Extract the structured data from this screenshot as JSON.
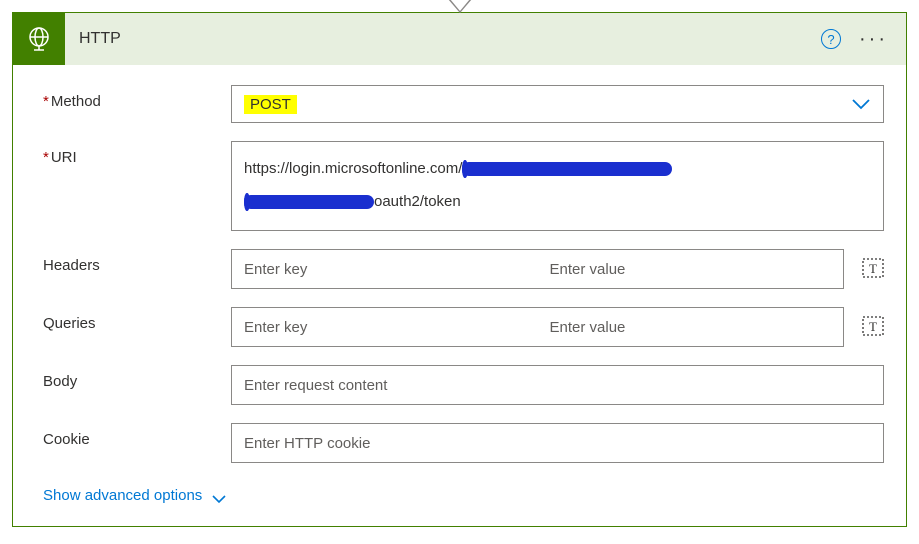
{
  "header": {
    "title": "HTTP",
    "help_tooltip": "?",
    "more_label": "···"
  },
  "fields": {
    "method": {
      "label": "Method",
      "value": "POST"
    },
    "uri": {
      "label": "URI",
      "prefix": "https://login.microsoftonline.com/",
      "mid": "oauth2/token"
    },
    "headers": {
      "label": "Headers",
      "key_placeholder": "Enter key",
      "value_placeholder": "Enter value"
    },
    "queries": {
      "label": "Queries",
      "key_placeholder": "Enter key",
      "value_placeholder": "Enter value"
    },
    "body": {
      "label": "Body",
      "placeholder": "Enter request content"
    },
    "cookie": {
      "label": "Cookie",
      "placeholder": "Enter HTTP cookie"
    }
  },
  "advanced_link": "Show advanced options"
}
